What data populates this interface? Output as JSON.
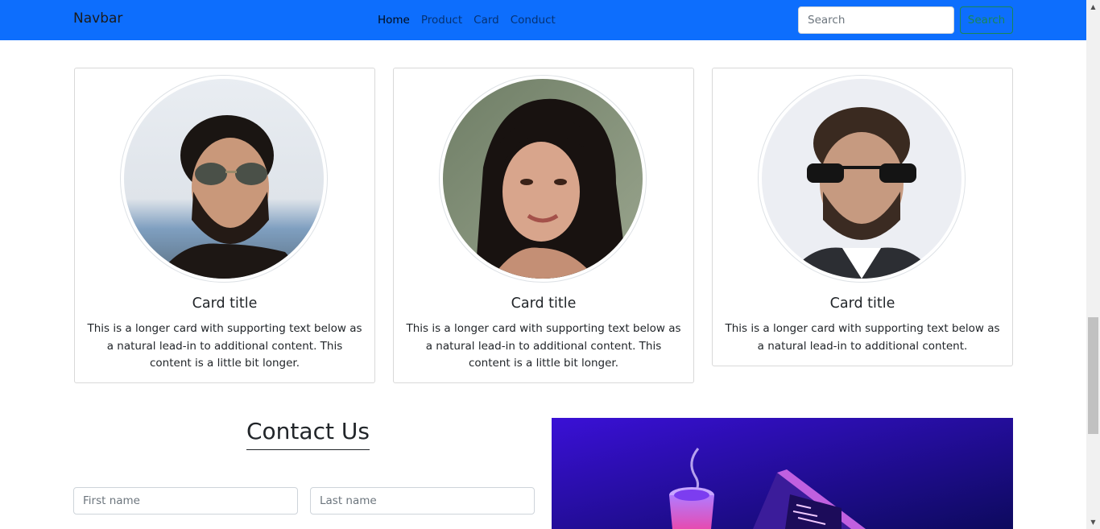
{
  "navbar": {
    "brand": "Navbar",
    "links": [
      "Home",
      "Product",
      "Card",
      "Conduct"
    ],
    "active_index": 0,
    "search_placeholder": "Search",
    "search_button": "Search"
  },
  "cards": [
    {
      "title": "Card title",
      "text": "This is a longer card with supporting text below as a natural lead-in to additional content. This content is a little bit longer.",
      "avatar_icon": "man-with-aviator-sunglasses-photo"
    },
    {
      "title": "Card title",
      "text": "This is a longer card with supporting text below as a natural lead-in to additional content. This content is a little bit longer.",
      "avatar_icon": "woman-smiling-photo"
    },
    {
      "title": "Card title",
      "text": "This is a longer card with supporting text below as a natural lead-in to additional content.",
      "avatar_icon": "man-in-suit-with-sunglasses-photo"
    }
  ],
  "contact": {
    "heading": "Contact Us",
    "first_name_placeholder": "First name",
    "last_name_placeholder": "Last name",
    "illustration_icon": "isometric-laptop-coffee-illustration"
  },
  "colors": {
    "navbar_bg": "#0d6efd",
    "search_button": "#198754",
    "illustration_gradient_start": "#3a10d6",
    "illustration_gradient_end": "#0d0a5e"
  }
}
